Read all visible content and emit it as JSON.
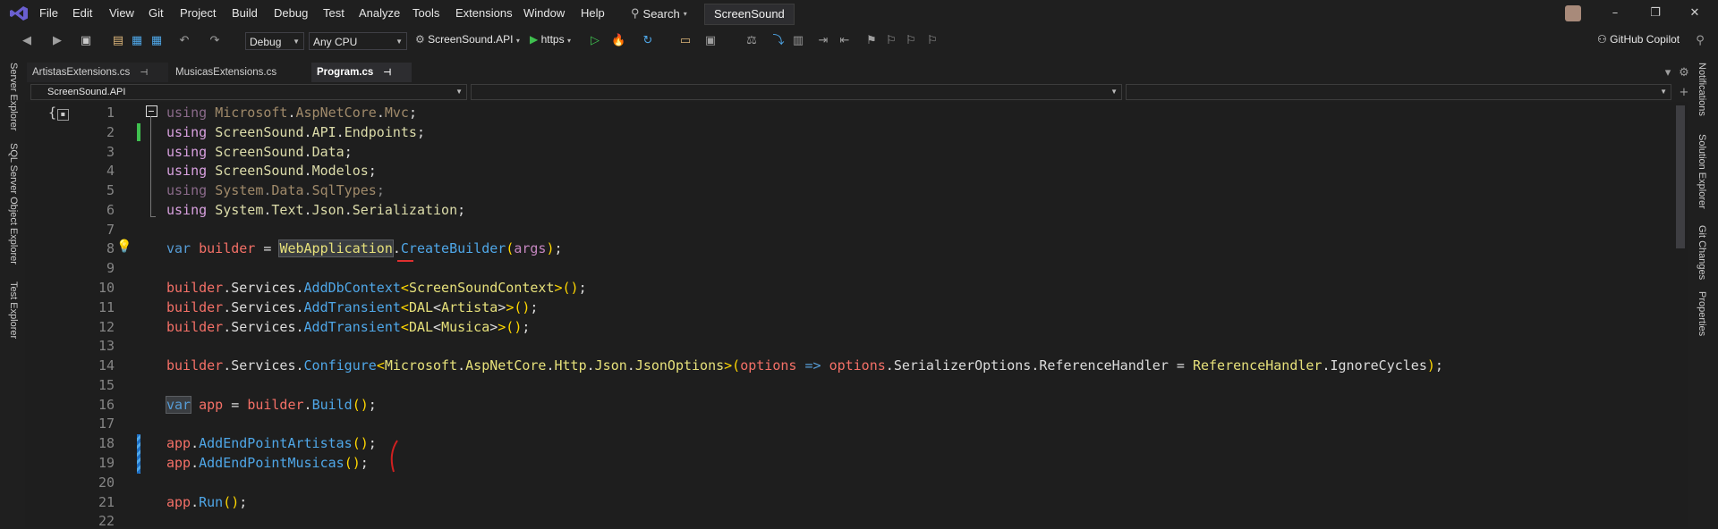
{
  "menubar": {
    "items": [
      "File",
      "Edit",
      "View",
      "Git",
      "Project",
      "Build",
      "Debug",
      "Test",
      "Analyze",
      "Tools",
      "Extensions",
      "Window",
      "Help"
    ],
    "search_label": "Search",
    "solution_name": "ScreenSound"
  },
  "toolbar": {
    "configuration": "Debug",
    "platform": "Any CPU",
    "startup_project": "ScreenSound.API",
    "run_profile": "https",
    "copilot_label": "GitHub Copilot"
  },
  "left_rail": [
    "Server Explorer",
    "SQL Server Object Explorer",
    "Test Explorer"
  ],
  "right_rail": [
    "Notifications",
    "Solution Explorer",
    "Git Changes",
    "Properties"
  ],
  "tabs": [
    {
      "label": "ArtistasExtensions.cs",
      "state": "open"
    },
    {
      "label": "MusicasExtensions.cs",
      "state": "open"
    },
    {
      "label": "Program.cs",
      "state": "active"
    }
  ],
  "navbar": {
    "project": "ScreenSound.API",
    "type": "",
    "member": ""
  },
  "editor": {
    "line_numbers": [
      "1",
      "2",
      "3",
      "4",
      "5",
      "6",
      "7",
      "8",
      "9",
      "10",
      "11",
      "12",
      "13",
      "14",
      "15",
      "16",
      "17",
      "18",
      "19",
      "20",
      "21",
      "22"
    ]
  },
  "colors": {
    "background": "#1e1e1e",
    "accent": "#007acc",
    "keyword": "#569cd6"
  }
}
